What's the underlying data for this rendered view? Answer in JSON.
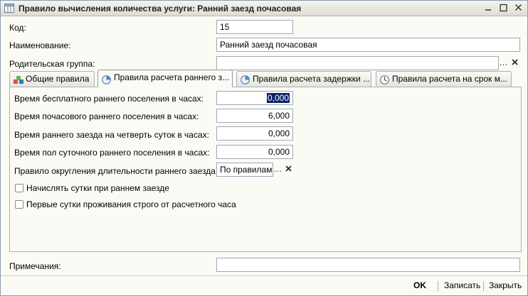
{
  "window": {
    "title": "Правило вычисления количества услуги: Ранний заезд почасовая"
  },
  "form": {
    "code": {
      "label": "Код:",
      "value": "15"
    },
    "name": {
      "label": "Наименование:",
      "value": "Ранний заезд почасовая"
    },
    "parent": {
      "label": "Родительская группа:",
      "value": ""
    }
  },
  "tabs": [
    {
      "label": "Общие правила",
      "icon": "general-rules-icon",
      "active": false
    },
    {
      "label": "Правила расчета раннего з...",
      "icon": "clock-icon",
      "active": true
    },
    {
      "label": "Правила расчета задержки ...",
      "icon": "clock-icon",
      "active": false
    },
    {
      "label": "Правила расчета на срок м...",
      "icon": "clock-icon",
      "active": false
    }
  ],
  "panel": {
    "free_early": {
      "label": "Время бесплатного раннего поселения в часах:",
      "value": "0,000"
    },
    "hourly_early": {
      "label": "Время почасового раннего поселения в часах:",
      "value": "6,000"
    },
    "quarter_early": {
      "label": "Время раннего заезда на четверть суток в часах:",
      "value": "0,000"
    },
    "half_early": {
      "label": "Время пол суточного раннего поселения в часах:",
      "value": "0,000"
    },
    "rounding": {
      "label": "Правило округления длительности раннего заезда:",
      "value": "По правилам с"
    },
    "charge_day": {
      "label": "Начислять сутки при раннем заезде",
      "checked": false
    },
    "first_day": {
      "label": "Первые сутки проживания строго от расчетного часа",
      "checked": false
    }
  },
  "notes": {
    "label": "Примечания:",
    "value": ""
  },
  "footer": {
    "ok": "OK",
    "save": "Записать",
    "close": "Закрыть"
  },
  "colors": {
    "selection": "#0a246a",
    "background": "#fbfbf6",
    "border": "#9fa8b4",
    "clear_x": "#222222"
  }
}
